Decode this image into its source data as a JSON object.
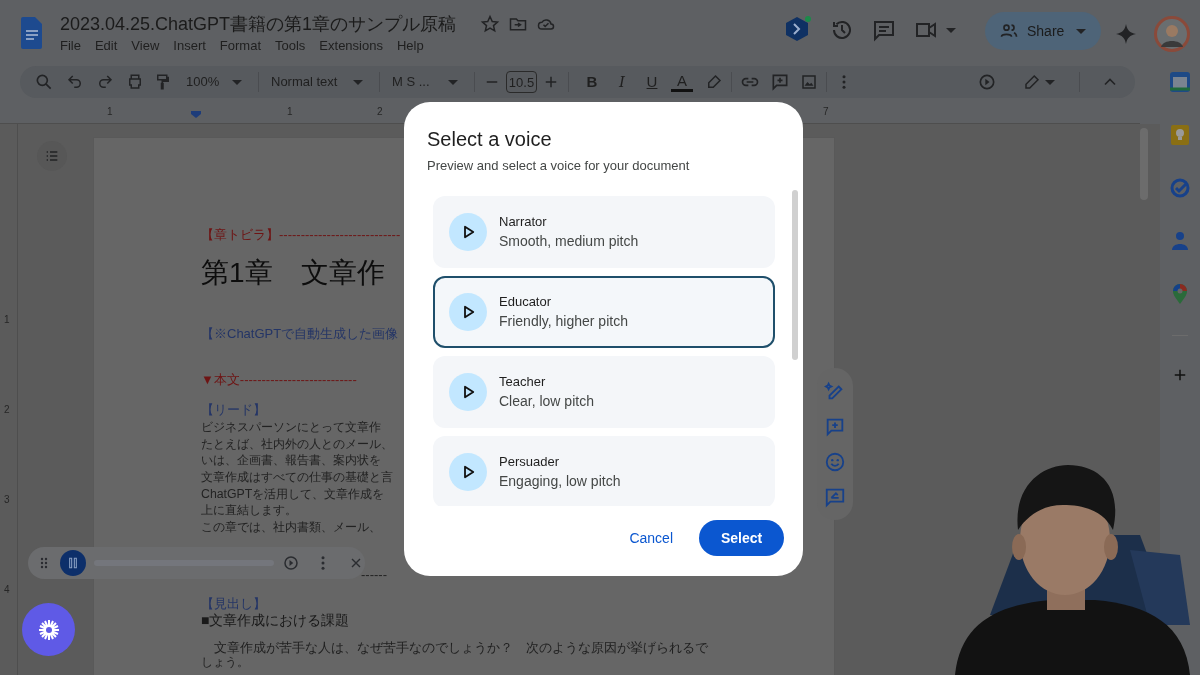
{
  "document": {
    "title": "2023.04.25.ChatGPT書籍の第1章のサンプル原稿",
    "menu": [
      "File",
      "Edit",
      "View",
      "Insert",
      "Format",
      "Tools",
      "Extensions",
      "Help"
    ],
    "share": "Share"
  },
  "toolbar": {
    "zoom": "100%",
    "style": "Normal text",
    "font": "M S ...",
    "font_size": "10.5",
    "format": [
      "B",
      "I",
      "U",
      "A"
    ]
  },
  "ruler": {
    "marks": [
      "1",
      "1",
      "2",
      "7"
    ],
    "side_marks": [
      "1",
      "2",
      "3",
      "4"
    ]
  },
  "body": [
    {
      "kind": "label",
      "text": "【章トビラ】----------------------------"
    },
    {
      "kind": "title",
      "text": "第1章　文章作"
    },
    {
      "kind": "note",
      "text": "【※ChatGPTで自動生成した画像"
    },
    {
      "kind": "section",
      "text": "▼本文---------------------------"
    },
    {
      "kind": "tag",
      "text": "【リード】"
    },
    {
      "kind": "body",
      "text": "ビジネスパーソンにとって文章作"
    },
    {
      "kind": "body",
      "text": "たとえば、社内外の人とのメール、"
    },
    {
      "kind": "body",
      "text": "いは、企画書、報告書、案内状を"
    },
    {
      "kind": "body",
      "text": "文章作成はすべての仕事の基礎と言"
    },
    {
      "kind": "body",
      "text": "ChatGPTを活用して、文章作成を"
    },
    {
      "kind": "body",
      "text": "上に直結します。"
    },
    {
      "kind": "body",
      "text": "この章では、社内書類、メール、"
    },
    {
      "kind": "covered",
      "text": "------"
    },
    {
      "kind": "tag",
      "text": "【見出し】"
    },
    {
      "kind": "heading",
      "text": "■文章作成における課題"
    },
    {
      "kind": "para",
      "text": "　文章作成が苦手な人は、なぜ苦手なのでしょうか？　次のような原因が挙げられるで"
    },
    {
      "kind": "body",
      "text": "しょう。"
    }
  ],
  "dialog": {
    "title": "Select a voice",
    "subtitle": "Preview and select a voice for your document",
    "voices": [
      {
        "name": "Narrator",
        "description": "Smooth, medium pitch",
        "selected": false
      },
      {
        "name": "Educator",
        "description": "Friendly, higher pitch",
        "selected": true
      },
      {
        "name": "Teacher",
        "description": "Clear, low pitch",
        "selected": false
      },
      {
        "name": "Persuader",
        "description": "Engaging, low pitch",
        "selected": false
      }
    ],
    "cancel": "Cancel",
    "confirm": "Select"
  },
  "player": {
    "playing": true
  }
}
